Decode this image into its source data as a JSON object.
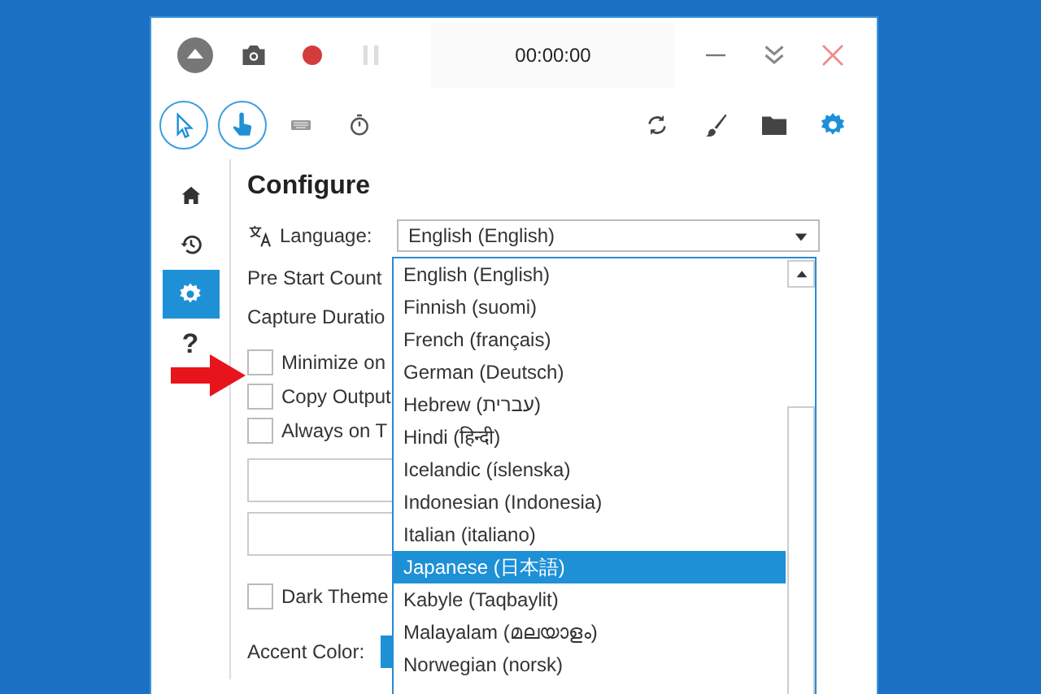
{
  "timer": "00:00:00",
  "tools": [
    {
      "kind": "cursor",
      "on": true
    },
    {
      "kind": "clicks",
      "on": true
    },
    {
      "kind": "keys",
      "on": false
    },
    {
      "kind": "timer",
      "on": false
    }
  ],
  "sidebar": {
    "items": [
      {
        "kind": "home",
        "selected": false
      },
      {
        "kind": "history",
        "selected": false
      },
      {
        "kind": "settings",
        "selected": true
      },
      {
        "kind": "help",
        "label": "?",
        "selected": false
      }
    ]
  },
  "configure": {
    "title": "Configure",
    "language": {
      "label": "Language:",
      "value": "English (English)"
    },
    "labels": [
      "Pre Start Count",
      "Capture Duratio"
    ],
    "checkboxes": [
      {
        "label": "Minimize on",
        "checked": false
      },
      {
        "label": "Copy Output",
        "checked": false
      },
      {
        "label": "Always on T",
        "checked": false
      }
    ],
    "dark_theme": {
      "label": "Dark Theme",
      "checked": false
    },
    "accent_color": {
      "label": "Accent Color:",
      "color": "#1e90d6"
    }
  },
  "language_dropdown": [
    {
      "label": "English (English)",
      "selected": false
    },
    {
      "label": "Finnish (suomi)",
      "selected": false
    },
    {
      "label": "French (français)",
      "selected": false
    },
    {
      "label": "German (Deutsch)",
      "selected": false
    },
    {
      "label": "Hebrew (עברית)",
      "selected": false
    },
    {
      "label": "Hindi (हिन्दी)",
      "selected": false
    },
    {
      "label": "Icelandic (íslenska)",
      "selected": false
    },
    {
      "label": "Indonesian (Indonesia)",
      "selected": false
    },
    {
      "label": "Italian (italiano)",
      "selected": false
    },
    {
      "label": "Japanese (日本語)",
      "selected": true
    },
    {
      "label": "Kabyle (Taqbaylit)",
      "selected": false
    },
    {
      "label": "Malayalam (മലയാളം)",
      "selected": false
    },
    {
      "label": "Norwegian (norsk)",
      "selected": false
    }
  ]
}
